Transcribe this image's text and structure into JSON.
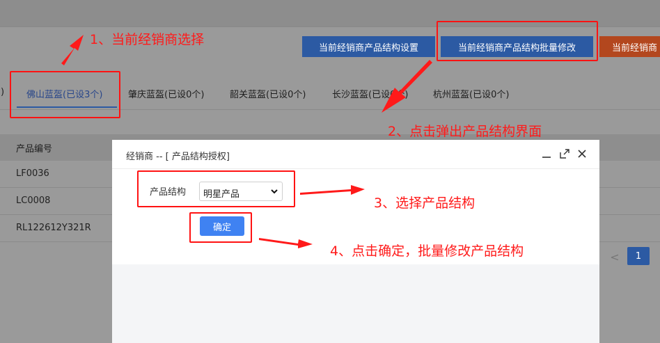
{
  "toolbar": {
    "structure_setting_label": "当前经销商产品结构设置",
    "batch_modify_label": "当前经销商产品结构批量修改",
    "third_label": "当前经销商"
  },
  "tabs": [
    {
      "label": ")",
      "active": false
    },
    {
      "label": "佛山蓝盔(已设3个)",
      "active": true
    },
    {
      "label": "肇庆蓝盔(已设0个)",
      "active": false
    },
    {
      "label": "韶关蓝盔(已设0个)",
      "active": false
    },
    {
      "label": "长沙蓝盔(已设0个)",
      "active": false
    },
    {
      "label": "杭州蓝盔(已设0个)",
      "active": false
    }
  ],
  "table": {
    "header": "产品编号",
    "rows": [
      "LF0036",
      "LC0008",
      "RL122612Y321R"
    ]
  },
  "pager": {
    "prev": "<",
    "current_page": "1"
  },
  "modal": {
    "title": "经销商 -- [ 产品结构授权]",
    "field_label": "产品结构",
    "select_value": "明星产品",
    "confirm_label": "确定"
  },
  "annotations": {
    "step1": "1、当前经销商选择",
    "step2": "2、点击弹出产品结构界面",
    "step3": "3、选择产品结构",
    "step4": "4、点击确定，批量修改产品结构"
  },
  "colors": {
    "annotation_red": "#ff1a1a",
    "primary_blue": "#3f82f2",
    "dimmed_blue": "#2c5aa3",
    "dimmed_orange": "#b3471e"
  },
  "icons": {
    "minimize": "minimize-icon",
    "maximize": "maximize-icon",
    "close": "close-icon",
    "select_arrow": "chevron-down-icon"
  }
}
